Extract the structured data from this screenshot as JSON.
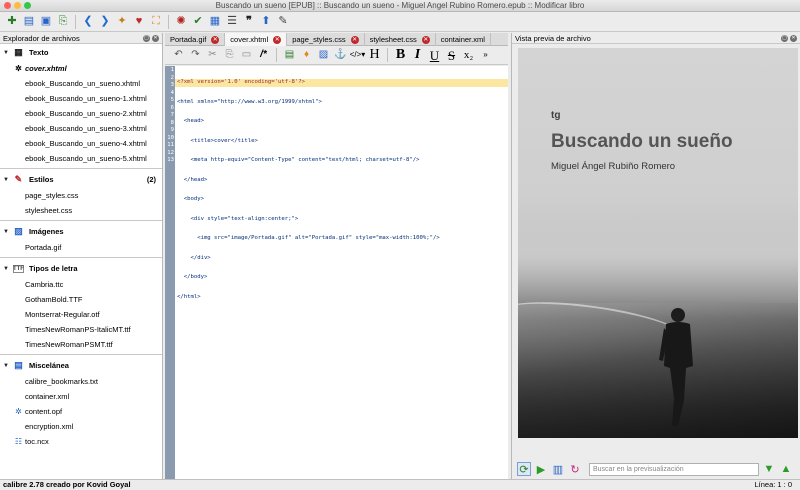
{
  "window": {
    "title": "Buscando un sueno [EPUB] :: Buscando un sueno - Miguel Angel Rubino Romero.epub :: Modificar libro"
  },
  "file_browser": {
    "title": "Explorador de archivos",
    "categories": [
      {
        "label": "Texto",
        "count": "",
        "files": [
          "cover.xhtml",
          "ebook_Buscando_un_sueno.xhtml",
          "ebook_Buscando_un_sueno-1.xhtml",
          "ebook_Buscando_un_sueno-2.xhtml",
          "ebook_Buscando_un_sueno-3.xhtml",
          "ebook_Buscando_un_sueno-4.xhtml",
          "ebook_Buscando_un_sueno-5.xhtml"
        ]
      },
      {
        "label": "Estilos",
        "count": "(2)",
        "files": [
          "page_styles.css",
          "stylesheet.css"
        ]
      },
      {
        "label": "Imágenes",
        "count": "",
        "files": [
          "Portada.gif"
        ]
      },
      {
        "label": "Tipos de letra",
        "count": "",
        "files": [
          "Cambria.ttc",
          "GothamBold.TTF",
          "Montserrat-Regular.otf",
          "TimesNewRomanPS-ItalicMT.ttf",
          "TimesNewRomanPSMT.ttf"
        ]
      },
      {
        "label": "Miscelánea",
        "count": "",
        "files": [
          "calibre_bookmarks.txt",
          "container.xml",
          "content.opf",
          "encryption.xml",
          "toc.ncx"
        ]
      }
    ]
  },
  "tabs": [
    "Portada.gif",
    "cover.xhtml",
    "page_styles.css",
    "stylesheet.css",
    "container.xml"
  ],
  "editor": {
    "line_numbers": [
      "1",
      "2",
      "3",
      "4",
      "5",
      "6",
      "7",
      "8",
      "9",
      "10",
      "11",
      "12",
      "13"
    ],
    "lines": [
      "<?xml version='1.0' encoding='utf-8'?>",
      "<html xmlns=\"http://www.w3.org/1999/xhtml\">",
      "  <head>",
      "    <title>cover</title>",
      "    <meta http-equiv=\"Content-Type\" content=\"text/html; charset=utf-8\"/>",
      "  </head>",
      "  <body>",
      "    <div style=\"text-align:center;\">",
      "      <img src=\"image/Portada.gif\" alt=\"Portada.gif\" style=\"max-width:100%;\"/>",
      "    </div>",
      "  </body>",
      "</html>",
      ""
    ]
  },
  "preview": {
    "title": "Vista previa de archivo",
    "book_logo": "tg",
    "book_title": "Buscando un sueño",
    "book_author": "Miguel Ángel Rubiño Romero",
    "search_placeholder": "Buscar en la previsualización"
  },
  "status": {
    "left": "calibre 2.78 creado por Kovid Goyal",
    "right": "Línea: 1 : 0"
  },
  "colors": {
    "accent_red": "#c0282b",
    "gutter": "#8a9bb0",
    "highlight": "#fbe6a2"
  },
  "icons": [
    "new-book-icon",
    "import-icon",
    "save-icon",
    "checkpoint-icon",
    "back-icon",
    "forward-icon",
    "fix-icon",
    "heart-icon",
    "fullscreen-icon",
    "bug-icon",
    "spell-check-icon",
    "reports-icon",
    "toc-icon",
    "quote-icon",
    "insert-icon"
  ]
}
